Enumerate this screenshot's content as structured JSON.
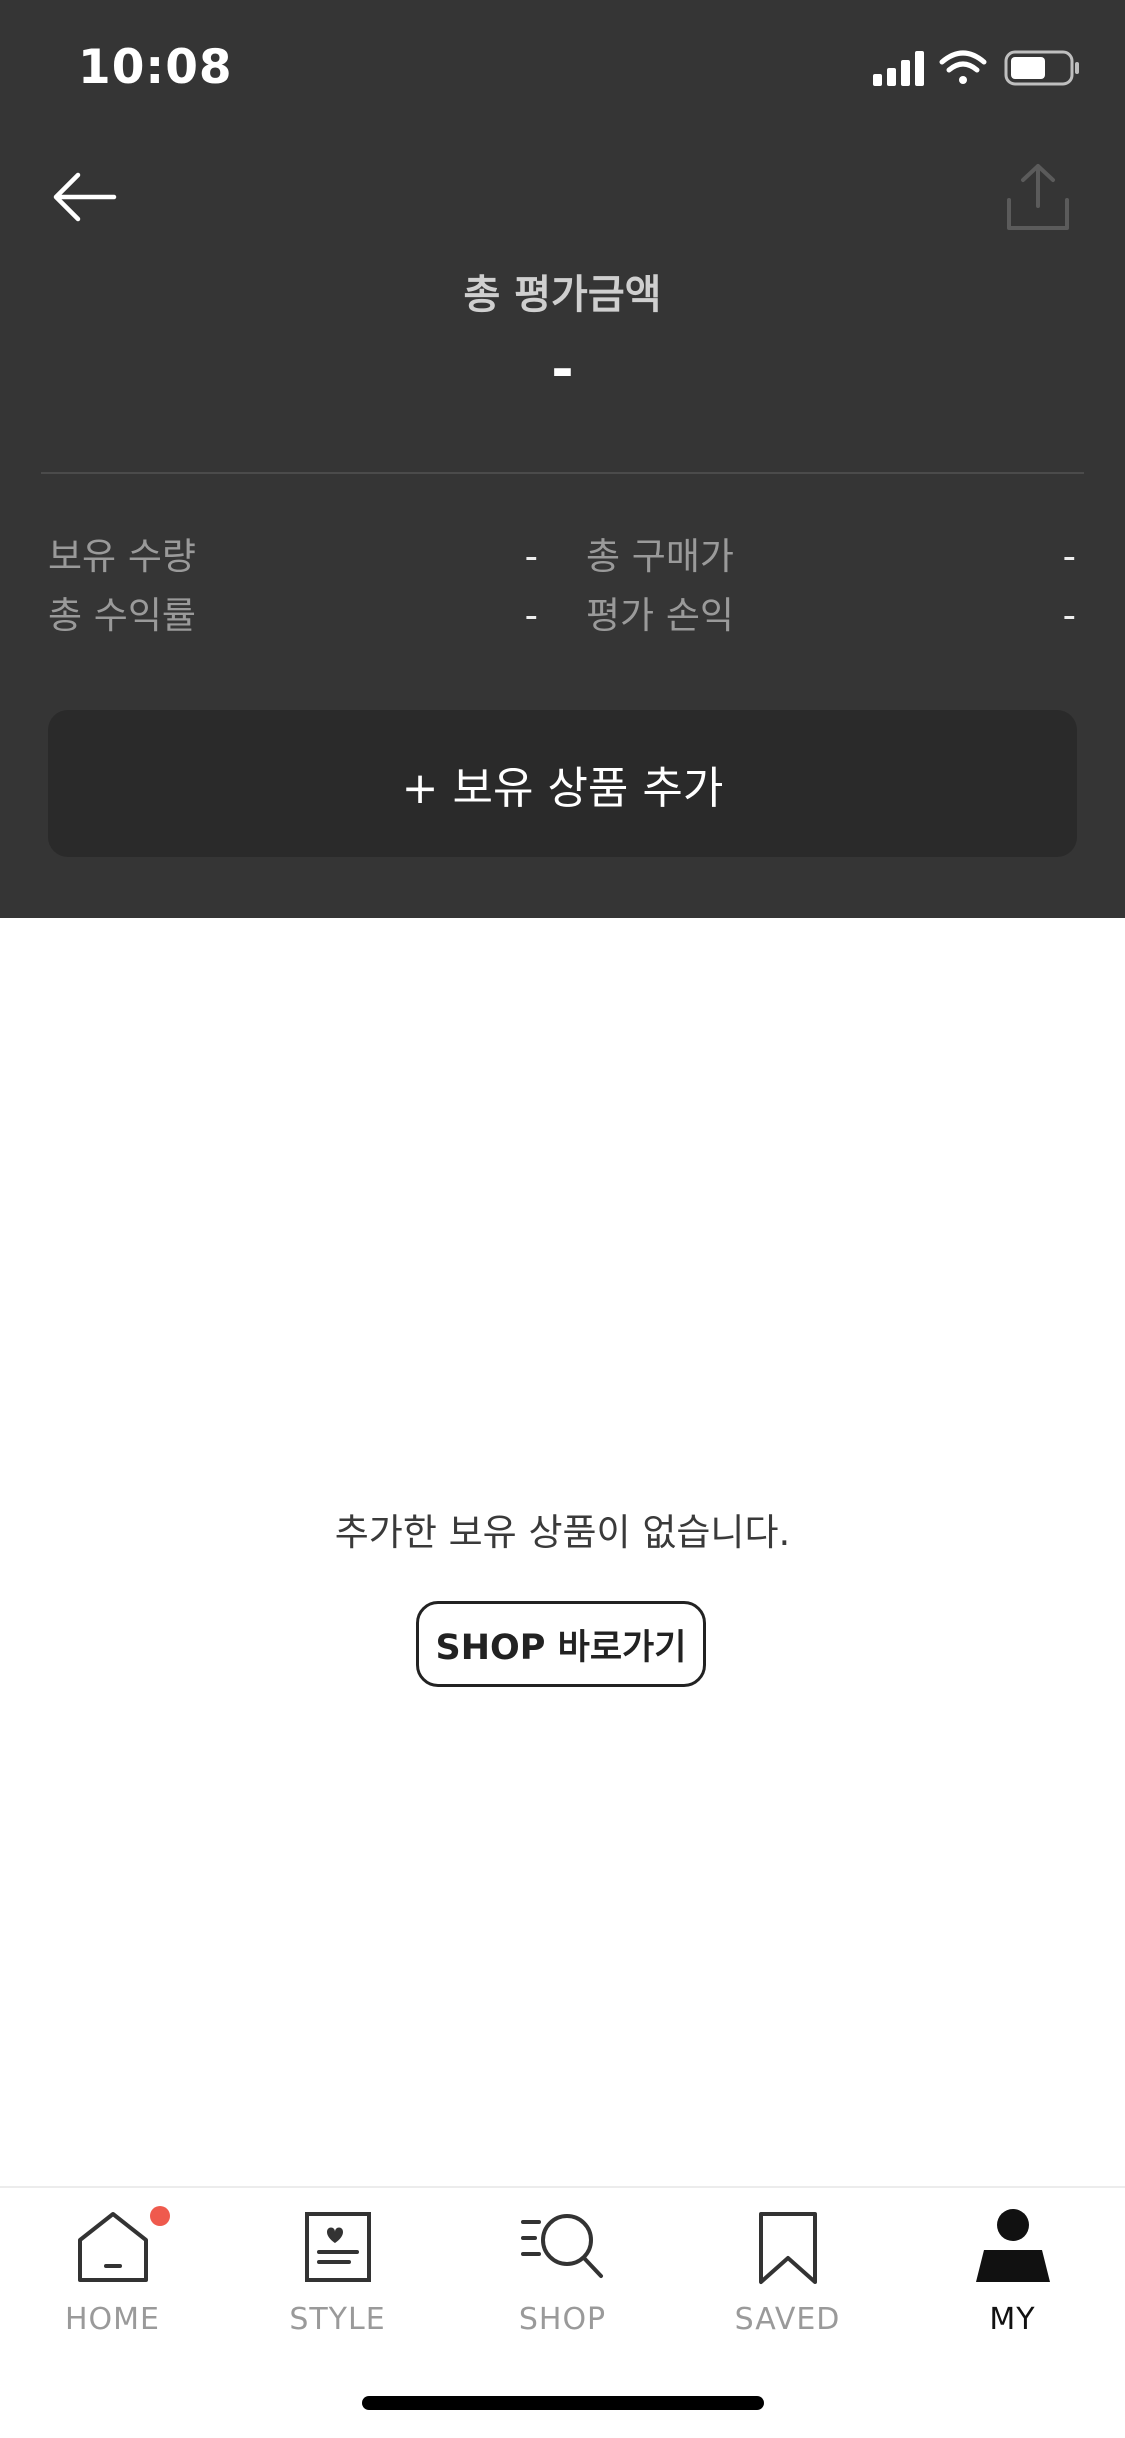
{
  "status_bar": {
    "time": "10:08"
  },
  "summary": {
    "title": "총 평가금액",
    "total_value": "-",
    "stats": [
      {
        "label": "보유 수량",
        "value": "-"
      },
      {
        "label": "총 구매가",
        "value": "-"
      },
      {
        "label": "총 수익률",
        "value": "-"
      },
      {
        "label": "평가 손익",
        "value": "-"
      }
    ],
    "add_button_label": "+ 보유 상품 추가"
  },
  "empty_state": {
    "message": "추가한 보유 상품이 없습니다.",
    "link_label": "SHOP 바로가기"
  },
  "tabbar": {
    "tabs": [
      {
        "label": "HOME",
        "icon": "home-icon",
        "has_badge": true
      },
      {
        "label": "STYLE",
        "icon": "style-icon"
      },
      {
        "label": "SHOP",
        "icon": "shop-search-icon"
      },
      {
        "label": "SAVED",
        "icon": "bookmark-icon"
      },
      {
        "label": "MY",
        "icon": "profile-icon",
        "active": true
      }
    ]
  },
  "colors": {
    "header_bg": "#353535",
    "add_button_bg": "#2a2a2a",
    "badge": "#ef5a4d",
    "active_tab": "#111111",
    "inactive_tab": "#9a9a9a"
  }
}
